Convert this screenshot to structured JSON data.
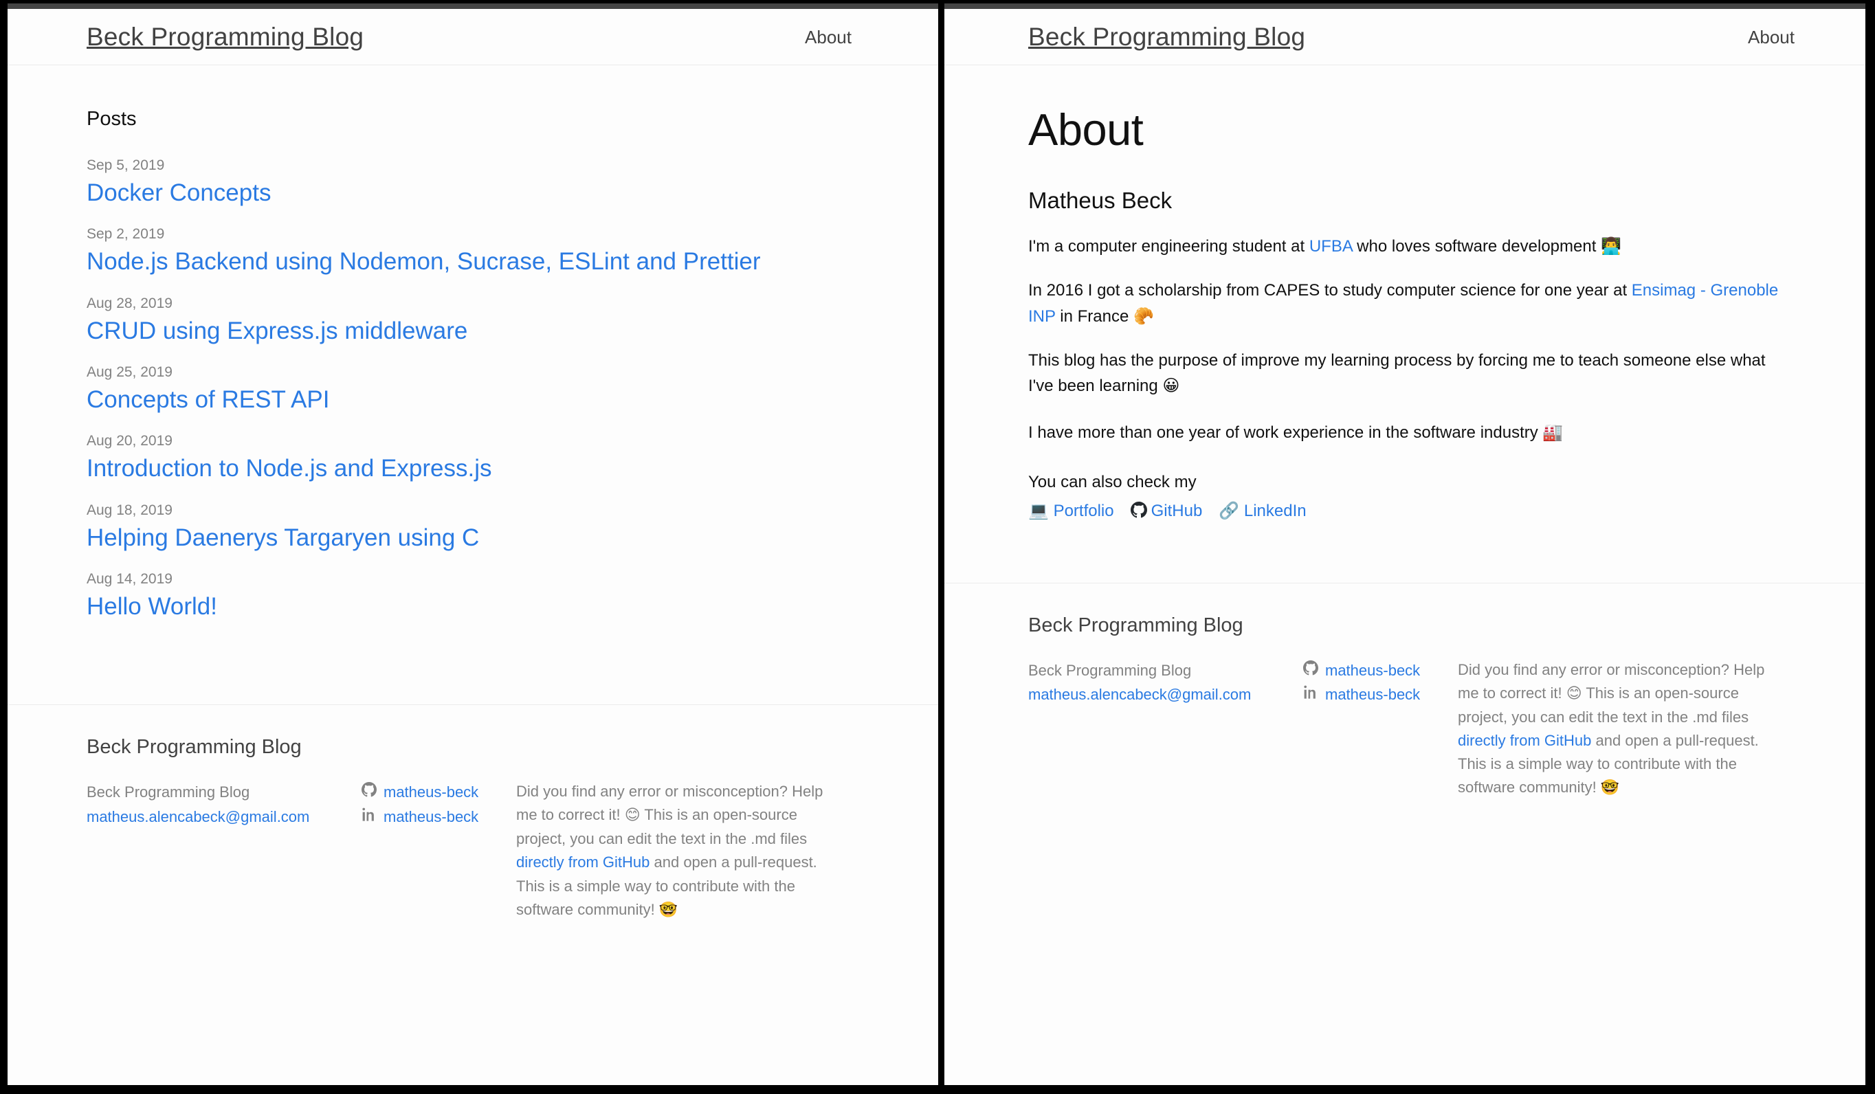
{
  "site": {
    "title": "Beck Programming Blog",
    "nav": {
      "about_label": "About"
    }
  },
  "left_panel": {
    "posts": {
      "heading": "Posts",
      "items": [
        {
          "date": "Sep 5, 2019",
          "title": "Docker Concepts"
        },
        {
          "date": "Sep 2, 2019",
          "title": "Node.js Backend using Nodemon, Sucrase, ESLint and Prettier"
        },
        {
          "date": "Aug 28, 2019",
          "title": "CRUD using Express.js middleware"
        },
        {
          "date": "Aug 25, 2019",
          "title": "Concepts of REST API"
        },
        {
          "date": "Aug 20, 2019",
          "title": "Introduction to Node.js and Express.js"
        },
        {
          "date": "Aug 18, 2019",
          "title": "Helping Daenerys Targaryen using C"
        },
        {
          "date": "Aug 14, 2019",
          "title": "Hello World!"
        }
      ]
    }
  },
  "right_panel": {
    "about": {
      "page_title": "About",
      "author_name": "Matheus Beck",
      "p1": {
        "before_link": "I'm a computer engineering student at ",
        "link": "UFBA",
        "after_link": " who loves software development ",
        "emoji": "👨‍💻"
      },
      "p2": {
        "before_link": "In 2016 I got a scholarship from CAPES to study computer science for one year at ",
        "link": "Ensimag - Grenoble INP",
        "after_link": " in France ",
        "emoji": "🥐"
      },
      "p3": {
        "text": "This blog has the purpose of improve my learning process by forcing me to teach someone else what I've been learning ",
        "emoji": "😀"
      },
      "p4": {
        "text": "I have more than one year of work experience in the software industry ",
        "emoji": "🏭"
      },
      "links_intro": "You can also check my",
      "links": [
        {
          "icon": "laptop-icon",
          "glyph": "💻",
          "label": "Portfolio"
        },
        {
          "icon": "github-icon",
          "glyph": "",
          "label": "GitHub"
        },
        {
          "icon": "link-icon",
          "glyph": "🔗",
          "label": "LinkedIn"
        }
      ]
    }
  },
  "footer": {
    "title": "Beck Programming Blog",
    "col1": {
      "name": "Beck Programming Blog",
      "email": "matheus.alencabeck@gmail.com"
    },
    "col2": {
      "github_handle": "matheus-beck",
      "linkedin_handle": "matheus-beck"
    },
    "col3": {
      "t1": "Did you find any error or misconception? Help me to correct it! ",
      "e1": "😊",
      "t2": " This is an open-source project, you can edit the text in the .md files ",
      "link": "directly from GitHub",
      "t3": " and open a pull-request. This is a simple way to contribute with the software community! ",
      "e2": "🤓"
    }
  },
  "colors": {
    "accent_link": "#2a7ae2",
    "muted_text": "#828282",
    "heading_text": "#111111",
    "header_bar": "#444444",
    "divider": "#ececec"
  }
}
